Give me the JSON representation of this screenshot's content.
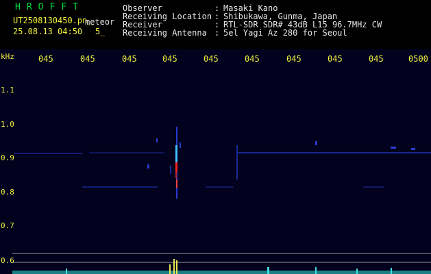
{
  "header": {
    "logo": "HROFFT",
    "filename": "UT2508130450.pn_",
    "tag": "meteor",
    "datetime": "25.08.13 04:50",
    "flag": "5_",
    "fields": [
      {
        "label": "Observer",
        "value": "Masaki Kano"
      },
      {
        "label": "Receiving Location",
        "value": "Shibukawa, Gunma, Japan"
      },
      {
        "label": "Receiver",
        "value": "RTL-SDR SDR# 43dB L15 96.7MHz CW"
      },
      {
        "label": "Receiving Antenna",
        "value": "5el Yagi Az 280 for Seoul"
      }
    ],
    "separator": ":"
  },
  "axis": {
    "unit": "kHz",
    "y_ticks": [
      "1.1",
      "1.0",
      "0.9",
      "0.8",
      "0.7",
      "0.6"
    ],
    "x_ticks": [
      "045",
      "045",
      "045",
      "045",
      "045",
      "045",
      "045",
      "045",
      "045",
      "0500"
    ]
  },
  "colors": {
    "background": "#02021e",
    "label_yellow": "#f0f040",
    "logo_green": "#00e040",
    "text_white": "#e8e8e8",
    "echo_strong": "#ff2020",
    "echo_mid": "#40c0ff",
    "signal_cyan": "#40e0e0"
  }
}
